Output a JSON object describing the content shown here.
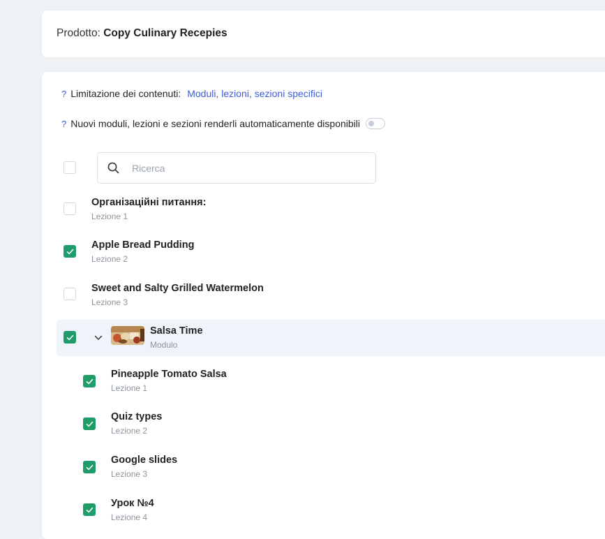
{
  "header": {
    "label": "Prodotto:",
    "product_name": "Copy Culinary Recepies"
  },
  "restriction": {
    "help": "?",
    "label": "Limitazione dei contenuti:",
    "value": "Moduli, lezioni, sezioni specifici"
  },
  "auto_available": {
    "help": "?",
    "label": "Nuovi moduli, lezioni e sezioni renderli automaticamente disponibili",
    "enabled": false
  },
  "search": {
    "placeholder": "Ricerca",
    "select_all_checked": false
  },
  "items": [
    {
      "title": "Організаційні питання:",
      "subtitle": "Lezione 1",
      "checked": false
    },
    {
      "title": "Apple Bread Pudding",
      "subtitle": "Lezione 2",
      "checked": true
    },
    {
      "title": "Sweet and Salty Grilled Watermelon",
      "subtitle": "Lezione 3",
      "checked": false
    }
  ],
  "module": {
    "title": "Salsa Time",
    "subtitle": "Modulo",
    "checked": true,
    "expanded": true,
    "icons": {
      "expand": "chevron-down-icon",
      "thumb": "module-thumbnail"
    }
  },
  "module_lessons": [
    {
      "title": "Pineapple Tomato Salsa",
      "subtitle": "Lezione 1",
      "checked": true
    },
    {
      "title": "Quiz types",
      "subtitle": "Lezione 2",
      "checked": true
    },
    {
      "title": "Google slides",
      "subtitle": "Lezione 3",
      "checked": true
    },
    {
      "title": "Урок №4",
      "subtitle": "Lezione 4",
      "checked": true
    }
  ],
  "colors": {
    "accent": "#3b5bdb",
    "check": "#1e9c6a",
    "highlight": "#eff4fb",
    "background": "#eff2f4"
  }
}
